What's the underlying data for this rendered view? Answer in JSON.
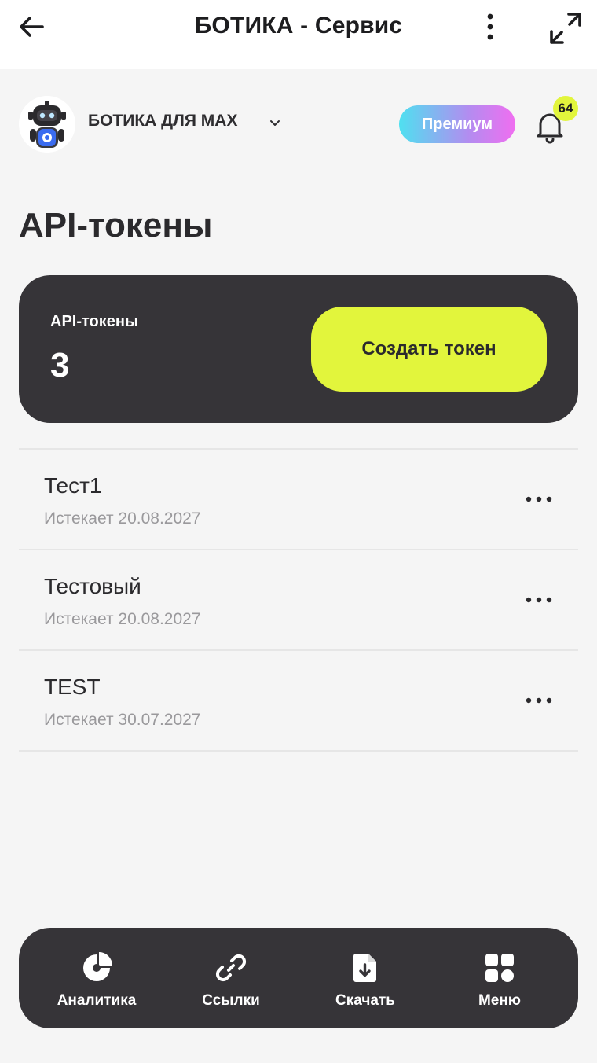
{
  "header": {
    "title": "БОТИКА - Сервис"
  },
  "account": {
    "name": "БОТИКА ДЛЯ MAX",
    "premium_label": "Премиум",
    "notifications_count": "64"
  },
  "page": {
    "title": "API-токены"
  },
  "summary": {
    "label": "API-токены",
    "count": "3",
    "create_button": "Создать токен"
  },
  "tokens": [
    {
      "name": "Тест1",
      "expires": "Истекает 20.08.2027"
    },
    {
      "name": "Тестовый",
      "expires": "Истекает 20.08.2027"
    },
    {
      "name": "TEST",
      "expires": "Истекает 30.07.2027"
    }
  ],
  "nav": {
    "items": [
      {
        "label": "Аналитика",
        "icon": "pie-chart-icon"
      },
      {
        "label": "Ссылки",
        "icon": "link-icon"
      },
      {
        "label": "Скачать",
        "icon": "download-file-icon"
      },
      {
        "label": "Меню",
        "icon": "grid-menu-icon"
      }
    ]
  },
  "colors": {
    "accent": "#e2f53c",
    "dark_card": "#363438",
    "background": "#f5f5f5"
  }
}
